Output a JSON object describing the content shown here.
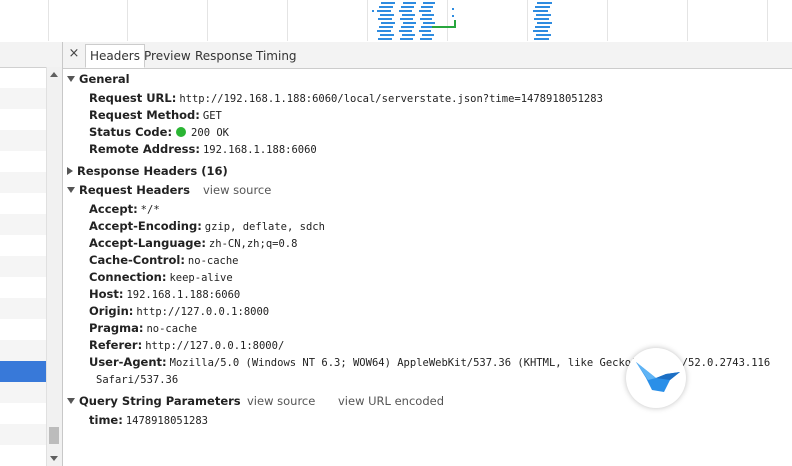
{
  "tabs": [
    {
      "label": "Headers",
      "active": true
    },
    {
      "label": "Preview",
      "active": false
    },
    {
      "label": "Response",
      "active": false
    },
    {
      "label": "Timing",
      "active": false
    }
  ],
  "close_glyph": "×",
  "general": {
    "title": "General",
    "rows": [
      {
        "key": "Request URL:",
        "value": "http://192.168.1.188:6060/local/serverstate.json?time=1478918051283"
      },
      {
        "key": "Request Method:",
        "value": "GET"
      },
      {
        "key": "Status Code:",
        "value": "200 OK"
      },
      {
        "key": "Remote Address:",
        "value": "192.168.1.188:6060"
      }
    ],
    "status_color": "#2bb534"
  },
  "response_headers": {
    "title": "Response Headers (16)"
  },
  "request_headers": {
    "title": "Request Headers",
    "view_source": "view source",
    "rows": [
      {
        "key": "Accept:",
        "value": "*/*"
      },
      {
        "key": "Accept-Encoding:",
        "value": "gzip, deflate, sdch"
      },
      {
        "key": "Accept-Language:",
        "value": "zh-CN,zh;q=0.8"
      },
      {
        "key": "Cache-Control:",
        "value": "no-cache"
      },
      {
        "key": "Connection:",
        "value": "keep-alive"
      },
      {
        "key": "Host:",
        "value": "192.168.1.188:6060"
      },
      {
        "key": "Origin:",
        "value": "http://127.0.0.1:8000"
      },
      {
        "key": "Pragma:",
        "value": "no-cache"
      },
      {
        "key": "Referer:",
        "value": "http://127.0.0.1:8000/"
      },
      {
        "key": "User-Agent:",
        "value": "Mozilla/5.0 (Windows NT 6.3; WOW64) AppleWebKit/537.36 (KHTML, like Gecko) Chrome/52.0.2743.116"
      }
    ],
    "user_agent_cont": "Safari/537.36"
  },
  "query_string": {
    "title": "Query String Parameters",
    "view_source": "view source",
    "view_url_encoded": "view URL encoded",
    "rows": [
      {
        "key": "time:",
        "value": "1478918051283"
      }
    ]
  },
  "colors": {
    "selected_row": "#3879d9",
    "timeline_bar": "#2f8ce0",
    "timeline_green": "#27a63d"
  },
  "icons": {
    "close": "close-icon",
    "expanded": "triangle-down-icon",
    "collapsed": "triangle-right-icon",
    "badge": "bird-logo-icon"
  }
}
